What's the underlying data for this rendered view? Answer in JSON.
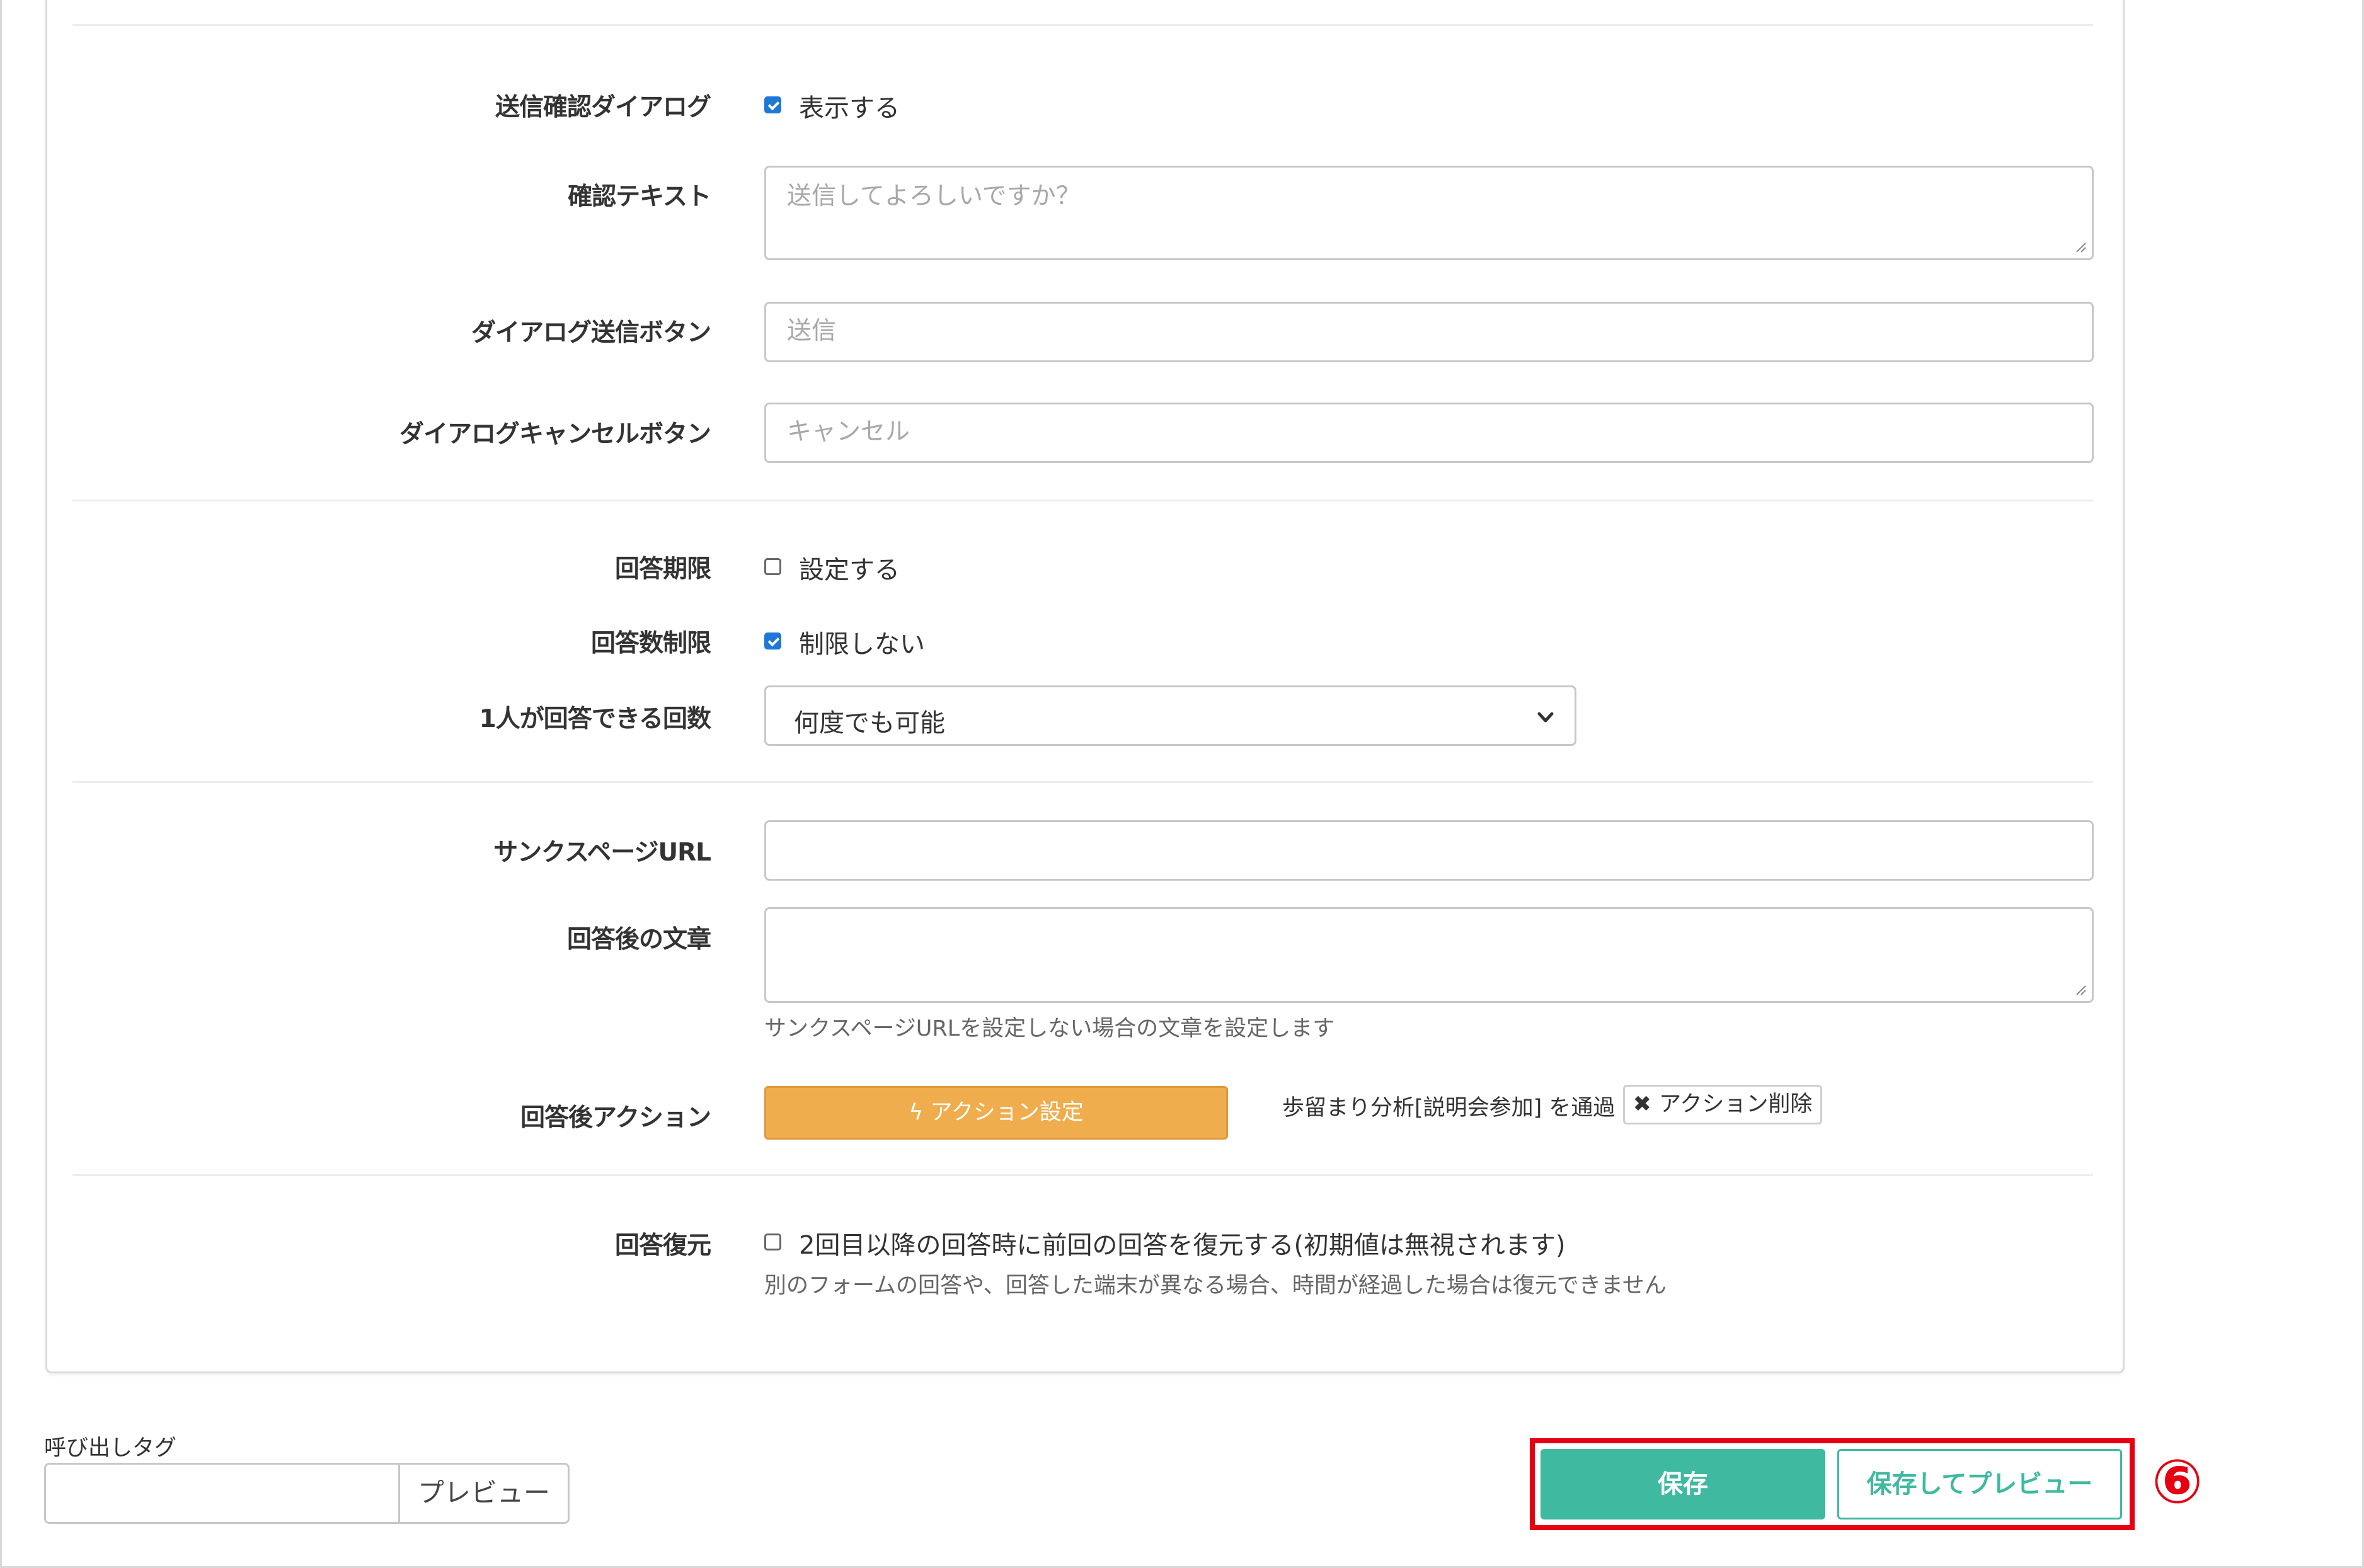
{
  "dialog_settings": {
    "confirm_dialog": {
      "label": "送信確認ダイアログ",
      "checkbox_text": "表示する",
      "checked": true
    },
    "confirm_text": {
      "label": "確認テキスト",
      "placeholder": "送信してよろしいですか？"
    },
    "dialog_submit_button": {
      "label": "ダイアログ送信ボタン",
      "placeholder": "送信"
    },
    "dialog_cancel_button": {
      "label": "ダイアログキャンセルボタン",
      "placeholder": "キャンセル"
    }
  },
  "limit_settings": {
    "deadline": {
      "label": "回答期限",
      "checkbox_text": "設定する",
      "checked": false
    },
    "answer_limit": {
      "label": "回答数制限",
      "checkbox_text": "制限しない",
      "checked": true
    },
    "per_person": {
      "label": "1人が回答できる回数",
      "selected": "何度でも可能"
    }
  },
  "after_answer": {
    "thanks_url": {
      "label": "サンクスページURL",
      "value": ""
    },
    "after_text": {
      "label": "回答後の文章",
      "help": "サンクスページURLを設定しない場合の文章を設定します"
    },
    "action": {
      "label": "回答後アクション",
      "button": "アクション設定",
      "info": "歩留まり分析[説明会参加] を通過",
      "delete_button": "アクション削除"
    }
  },
  "restore": {
    "label": "回答復元",
    "checkbox_text": "2回目以降の回答時に前回の回答を復元する(初期値は無視されます)",
    "checked": false,
    "help": "別のフォームの回答や、回答した端末が異なる場合、時間が経過した場合は復元できません"
  },
  "footer": {
    "tag_label": "呼び出しタグ",
    "preview_button": "プレビュー",
    "save_button": "保存",
    "save_preview_button": "保存してプレビュー",
    "marker": "⑥"
  },
  "colors": {
    "accent": "#3fb9a0",
    "action": "#f0ad4e",
    "highlight": "#e60012",
    "checkbox": "#1e78d7"
  }
}
